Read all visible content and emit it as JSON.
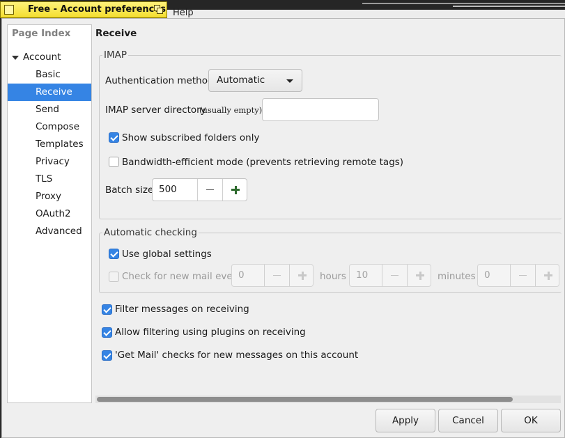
{
  "background_window": {
    "menu_peek": "Help"
  },
  "window": {
    "title": "Free - Account preferences"
  },
  "sidebar": {
    "header": "Page Index",
    "root": "Account",
    "items": [
      "Basic",
      "Receive",
      "Send",
      "Compose",
      "Templates",
      "Privacy",
      "TLS",
      "Proxy",
      "OAuth2",
      "Advanced"
    ],
    "selected": "Receive"
  },
  "page": {
    "title": "Receive"
  },
  "imap": {
    "legend": "IMAP",
    "auth_label": "Authentication method",
    "auth_value": "Automatic",
    "dir_label": "IMAP server directory",
    "dir_hint": "(usually empty)",
    "dir_value": "",
    "subscribed_label": "Show subscribed folders only",
    "subscribed_checked": true,
    "bandwidth_label": "Bandwidth-efficient mode (prevents retrieving remote tags)",
    "bandwidth_checked": false,
    "batch_label": "Batch size",
    "batch_value": "500"
  },
  "auto_check": {
    "legend": "Automatic checking",
    "global_label": "Use global settings",
    "global_checked": true,
    "check_label": "Check for new mail every",
    "check_checked": false,
    "days_value": "0",
    "hours_label": "hours",
    "hours_value": "10",
    "minutes_label": "minutes",
    "minutes_value": "0"
  },
  "options": [
    {
      "label": "Filter messages on receiving",
      "checked": true
    },
    {
      "label": "Allow filtering using plugins on receiving",
      "checked": true
    },
    {
      "label": "'Get Mail' checks for new messages on this account",
      "checked": true
    }
  ],
  "buttons": {
    "apply": "Apply",
    "cancel": "Cancel",
    "ok": "OK"
  },
  "colors": {
    "accent": "#3584e4",
    "title_bar": "#f4de2f",
    "plus_icon": "#2e6b2e"
  }
}
